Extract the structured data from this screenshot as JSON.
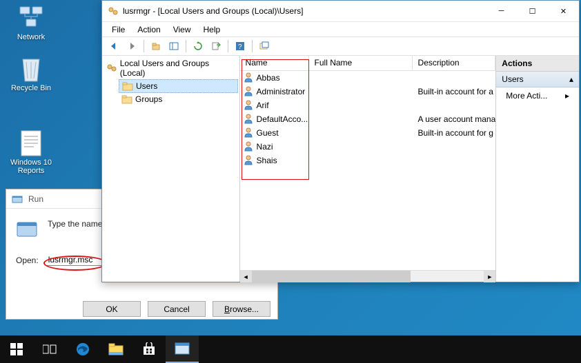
{
  "desktop": {
    "network": "Network",
    "recycle": "Recycle Bin",
    "reports": "Windows 10 Reports"
  },
  "run": {
    "title": "Run",
    "prompt": "Type the name resource, and",
    "open_label": "Open:",
    "value": "lusrmgr.msc",
    "ok": "OK",
    "cancel": "Cancel",
    "browse": "Browse..."
  },
  "mmc": {
    "title": "lusrmgr - [Local Users and Groups (Local)\\Users]",
    "menu": {
      "file": "File",
      "action": "Action",
      "view": "View",
      "help": "Help"
    },
    "tree": {
      "root": "Local Users and Groups (Local)",
      "users": "Users",
      "groups": "Groups"
    },
    "columns": {
      "name": "Name",
      "fullname": "Full Name",
      "desc": "Description"
    },
    "users": [
      {
        "name": "Abbas",
        "full": "",
        "desc": ""
      },
      {
        "name": "Administrator",
        "full": "",
        "desc": "Built-in account for a"
      },
      {
        "name": "Arif",
        "full": "",
        "desc": ""
      },
      {
        "name": "DefaultAcco...",
        "full": "",
        "desc": "A user account mana"
      },
      {
        "name": "Guest",
        "full": "",
        "desc": "Built-in account for g"
      },
      {
        "name": "Nazi",
        "full": "",
        "desc": ""
      },
      {
        "name": "Shais",
        "full": "",
        "desc": ""
      }
    ],
    "actions": {
      "header": "Actions",
      "group": "Users",
      "more": "More Acti..."
    }
  }
}
